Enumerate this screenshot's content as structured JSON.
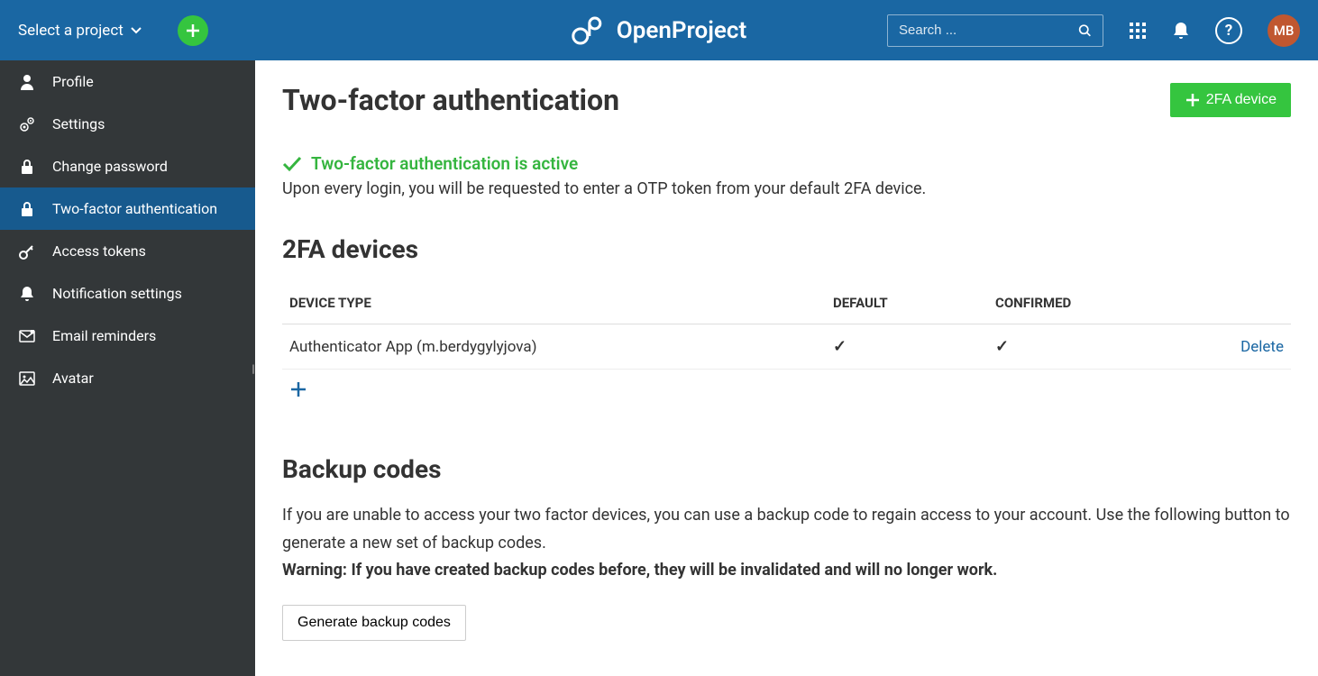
{
  "header": {
    "project_select_label": "Select a project",
    "brand_name": "OpenProject",
    "search_placeholder": "Search ...",
    "avatar_initials": "MB"
  },
  "sidebar": {
    "items": [
      {
        "label": "Profile"
      },
      {
        "label": "Settings"
      },
      {
        "label": "Change password"
      },
      {
        "label": "Two-factor authentication"
      },
      {
        "label": "Access tokens"
      },
      {
        "label": "Notification settings"
      },
      {
        "label": "Email reminders"
      },
      {
        "label": "Avatar"
      }
    ]
  },
  "main": {
    "title": "Two-factor authentication",
    "add_device_label": "2FA device",
    "status_heading": "Two-factor authentication is active",
    "status_description": "Upon every login, you will be requested to enter a OTP token from your default 2FA device.",
    "devices_heading": "2FA devices",
    "table": {
      "columns": {
        "device": "DEVICE TYPE",
        "default": "DEFAULT",
        "confirmed": "CONFIRMED"
      },
      "rows": [
        {
          "device": "Authenticator App (m.berdygylyjova)",
          "default": true,
          "confirmed": true,
          "action": "Delete"
        }
      ]
    },
    "backup": {
      "heading": "Backup codes",
      "description": "If you are unable to access your two factor devices, you can use a backup code to regain access to your account. Use the following button to generate a new set of backup codes.",
      "warning": "Warning: If you have created backup codes before, they will be invalidated and will no longer work.",
      "button_label": "Generate backup codes"
    }
  }
}
